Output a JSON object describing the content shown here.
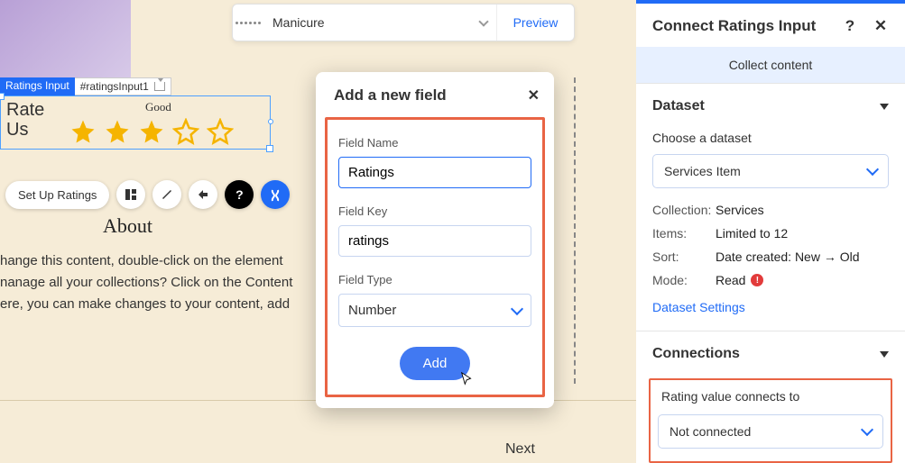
{
  "top_selector": {
    "value": "Manicure",
    "preview": "Preview"
  },
  "element_tags": {
    "type": "Ratings Input",
    "id": "#ratingsInput1"
  },
  "rating_widget": {
    "tooltip": "Good",
    "label_line1": "Rate",
    "label_line2": "Us",
    "filled_stars": 3,
    "total_stars": 5
  },
  "toolbar": {
    "setup": "Set Up Ratings"
  },
  "about": {
    "heading": "About",
    "p1": "hange this content, double-click on the element",
    "p2": "nanage all your collections? Click on the Content",
    "p3": "ere, you can make changes to your content, add"
  },
  "nav": {
    "next": "Next"
  },
  "modal": {
    "title": "Add a new field",
    "field_name_label": "Field Name",
    "field_name_value": "Ratings",
    "field_key_label": "Field Key",
    "field_key_value": "ratings",
    "field_type_label": "Field Type",
    "field_type_value": "Number",
    "add": "Add"
  },
  "panel": {
    "title": "Connect Ratings Input",
    "collect": "Collect content",
    "dataset_section": "Dataset",
    "choose_dataset": "Choose a dataset",
    "dataset_value": "Services Item",
    "collection_k": "Collection:",
    "collection_v": "Services",
    "items_k": "Items:",
    "items_v": "Limited to 12",
    "sort_k": "Sort:",
    "sort_v": "Date created: New → Old",
    "mode_k": "Mode:",
    "mode_v": "Read",
    "dataset_settings": "Dataset Settings",
    "connections_section": "Connections",
    "rating_connects": "Rating value connects to",
    "rating_connects_value": "Not connected"
  }
}
